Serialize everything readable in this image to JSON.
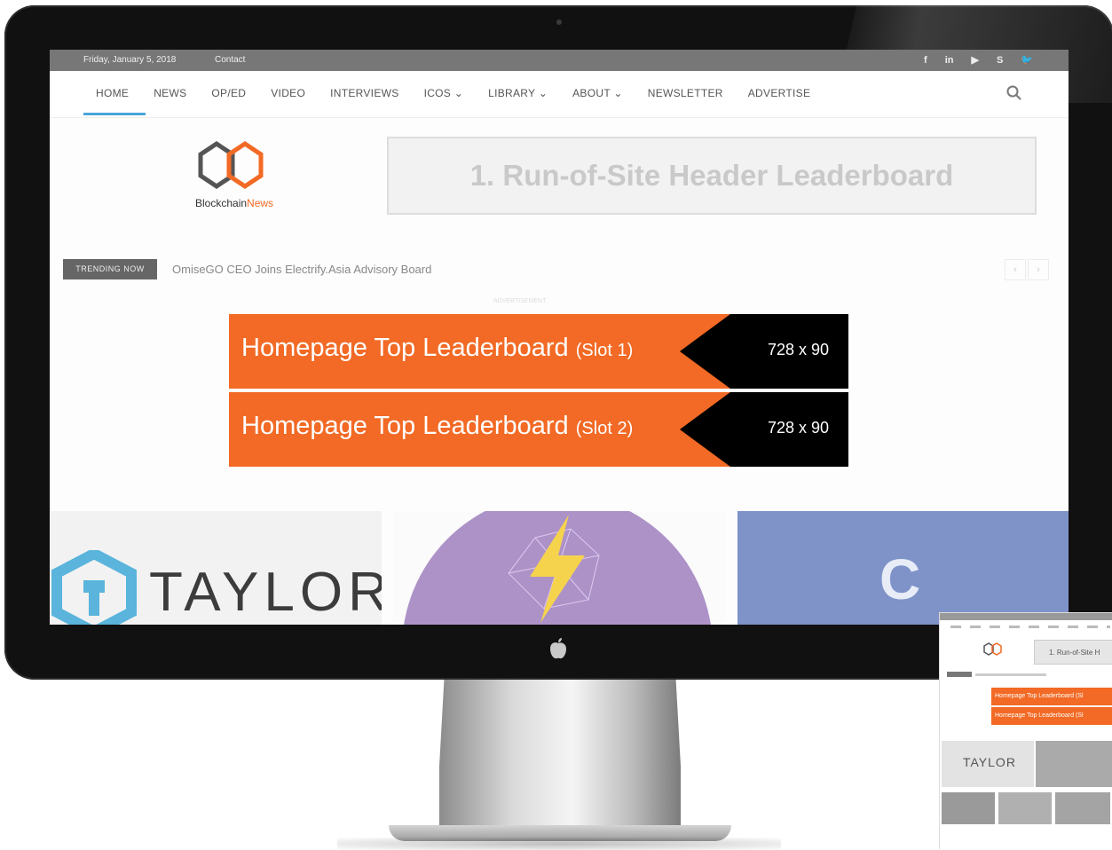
{
  "topbar": {
    "date": "Friday, January 5, 2018",
    "contact": "Contact",
    "social_icons": [
      "facebook-icon",
      "linkedin-icon",
      "youtube-icon",
      "skype-icon",
      "twitter-icon"
    ],
    "social_glyphs": [
      "f",
      "in",
      "▶",
      "S",
      "🐦"
    ]
  },
  "nav": {
    "items": [
      "HOME",
      "NEWS",
      "OP/ED",
      "VIDEO",
      "INTERVIEWS",
      "ICOS ⌄",
      "LIBRARY ⌄",
      "ABOUT ⌄",
      "NEWSLETTER",
      "ADVERTISE"
    ],
    "active_color": "#4aa3d8"
  },
  "logo": {
    "word1": "Blockchain",
    "word2": "News"
  },
  "header_leaderboard": "1. Run-of-Site Header Leaderboard",
  "trending": {
    "badge": "TRENDING NOW",
    "headline": "OmiseGO CEO Joins Electrify.Asia Advisory Board",
    "prev": "‹",
    "next": "›"
  },
  "ad_label": "ADVERTISEMENT",
  "ads": [
    {
      "title": "Homepage Top Leaderboard",
      "slot": "(Slot 1)",
      "size": "728 x 90"
    },
    {
      "title": "Homepage Top Leaderboard",
      "slot": "(Slot 2)",
      "size": "728 x 90"
    }
  ],
  "cards": {
    "card1_text": "TAYLOR",
    "card3_logo": "C"
  },
  "mini": {
    "leader": "1. Run-of-Site H",
    "ad1": "Homepage Top Leaderboard (Sl",
    "ad2": "Homepage Top Leaderboard (Sl",
    "taylor": "TAYLOR"
  },
  "colors": {
    "accent_orange": "#f26a25",
    "topbar_gray": "#777777",
    "card3_blue": "#7f93c9",
    "card2_purple": "#ad92c8"
  }
}
